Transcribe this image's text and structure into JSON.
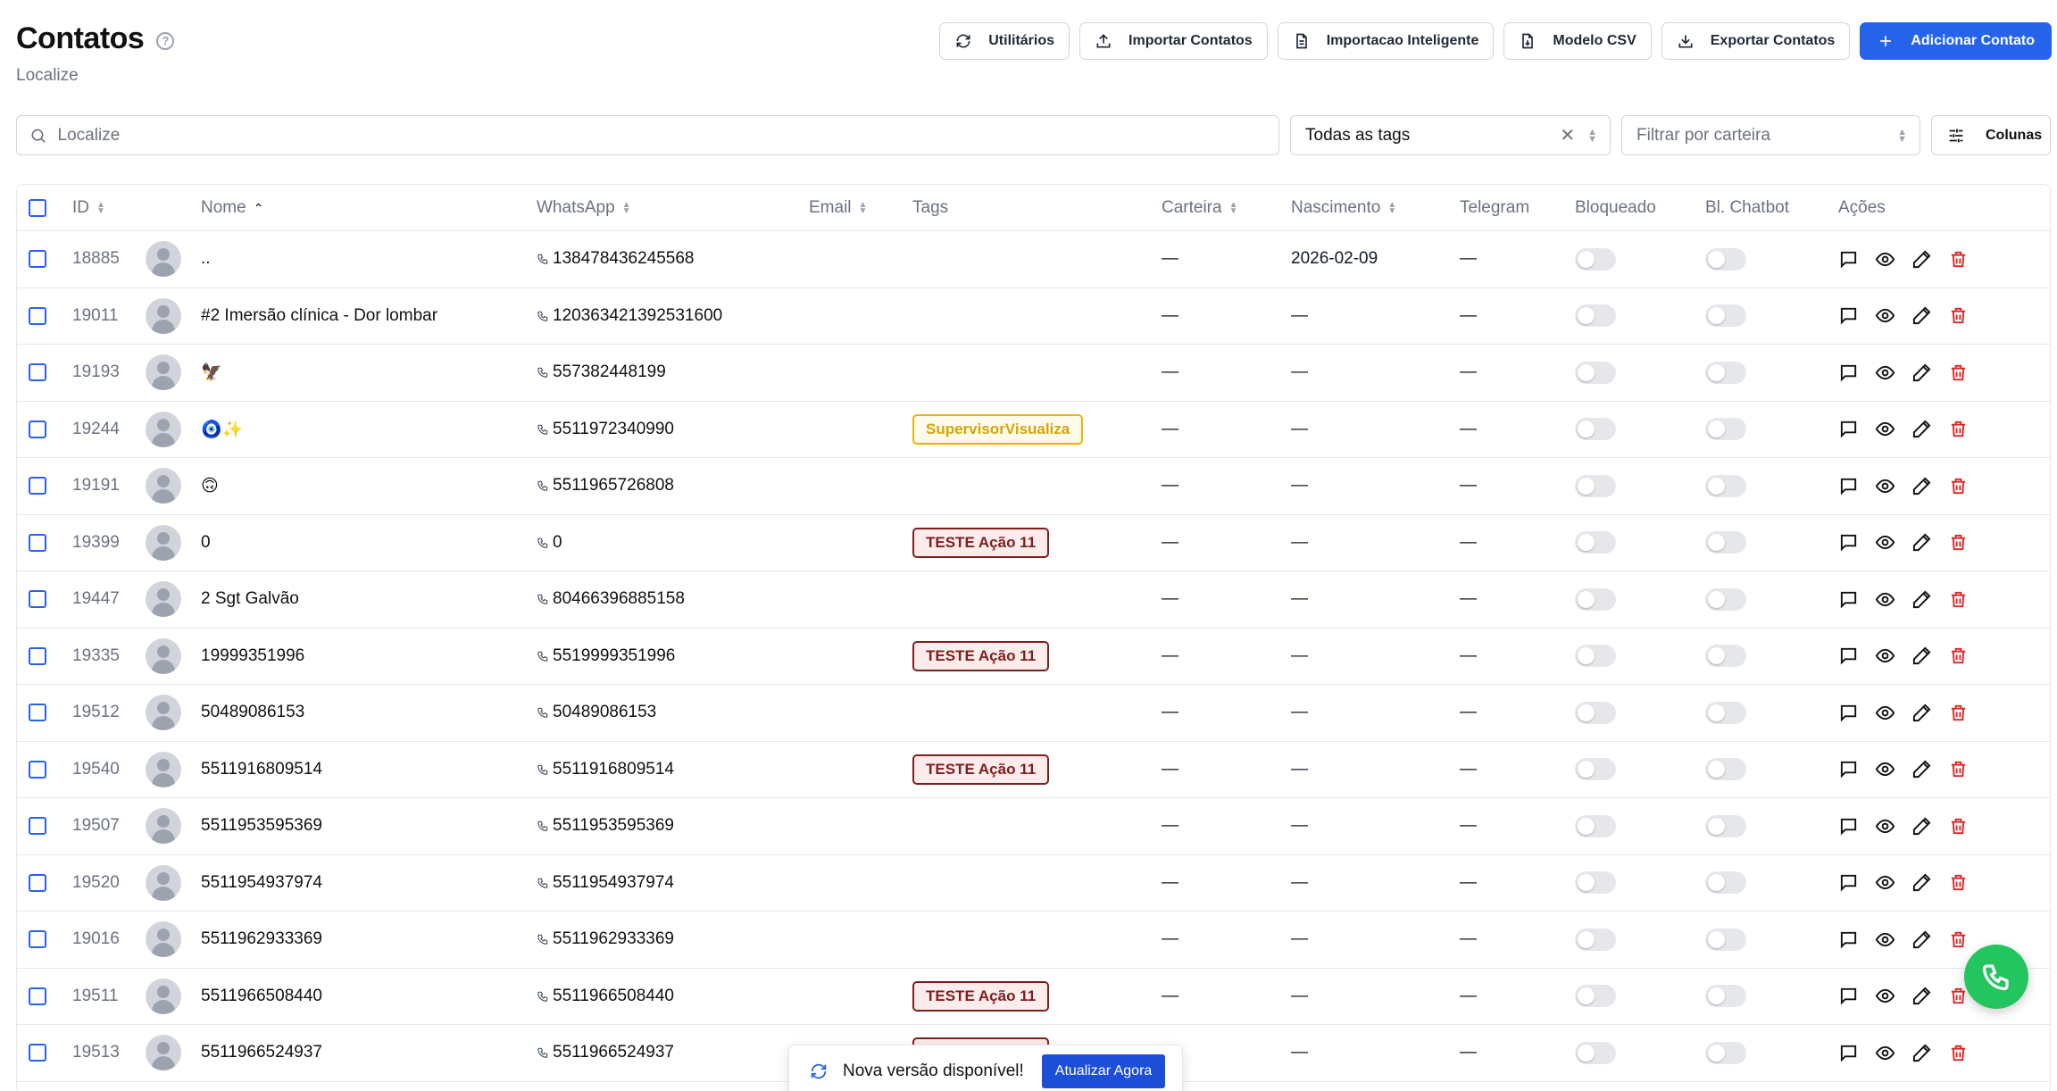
{
  "header": {
    "title": "Contatos",
    "subtitle": "Localize"
  },
  "toolbar": {
    "utilities": "Utilitários",
    "import_contacts": "Importar Contatos",
    "smart_import": "Importacao Inteligente",
    "csv_model": "Modelo CSV",
    "export_contacts": "Exportar Contatos",
    "add_contact": "Adicionar Contato"
  },
  "filters": {
    "search_placeholder": "Localize",
    "tags_selected": "Todas as tags",
    "wallet_placeholder": "Filtrar por carteira",
    "columns_label": "Colunas"
  },
  "table": {
    "headers": {
      "id": "ID",
      "name": "Nome",
      "whatsapp": "WhatsApp",
      "email": "Email",
      "tags": "Tags",
      "wallet": "Carteira",
      "birth": "Nascimento",
      "telegram": "Telegram",
      "blocked": "Bloqueado",
      "chatbot": "Bl. Chatbot",
      "actions": "Ações"
    },
    "dash": "—",
    "rows": [
      {
        "id": "18885",
        "name": "..",
        "whatsapp": "138478436245568",
        "tag": "",
        "birth": "2026-02-09"
      },
      {
        "id": "19011",
        "name": "#2 Imersão clínica - Dor lombar",
        "whatsapp": "120363421392531600",
        "tag": "",
        "birth": "—"
      },
      {
        "id": "19193",
        "name": "🦅",
        "whatsapp": "557382448199",
        "tag": "",
        "birth": "—"
      },
      {
        "id": "19244",
        "name": "🧿✨",
        "whatsapp": "5511972340990",
        "tag": "SupervisorVisualiza",
        "tag_color": "yellow",
        "birth": "—"
      },
      {
        "id": "19191",
        "name": "🙃",
        "whatsapp": "5511965726808",
        "tag": "",
        "birth": "—"
      },
      {
        "id": "19399",
        "name": "0",
        "whatsapp": "0",
        "tag": "TESTE Ação 11",
        "tag_color": "red",
        "birth": "—"
      },
      {
        "id": "19447",
        "name": "2 Sgt Galvão",
        "whatsapp": "80466396885158",
        "tag": "",
        "birth": "—"
      },
      {
        "id": "19335",
        "name": "19999351996",
        "whatsapp": "5519999351996",
        "tag": "TESTE Ação 11",
        "tag_color": "red",
        "birth": "—"
      },
      {
        "id": "19512",
        "name": "50489086153",
        "whatsapp": "50489086153",
        "tag": "",
        "birth": "—"
      },
      {
        "id": "19540",
        "name": "5511916809514",
        "whatsapp": "5511916809514",
        "tag": "TESTE Ação 11",
        "tag_color": "red",
        "birth": "—"
      },
      {
        "id": "19507",
        "name": "5511953595369",
        "whatsapp": "5511953595369",
        "tag": "",
        "birth": "—"
      },
      {
        "id": "19520",
        "name": "5511954937974",
        "whatsapp": "5511954937974",
        "tag": "",
        "birth": "—"
      },
      {
        "id": "19016",
        "name": "5511962933369",
        "whatsapp": "5511962933369",
        "tag": "",
        "birth": "—"
      },
      {
        "id": "19511",
        "name": "5511966508440",
        "whatsapp": "5511966508440",
        "tag": "TESTE Ação 11",
        "tag_color": "red",
        "birth": "—"
      },
      {
        "id": "19513",
        "name": "5511966524937",
        "whatsapp": "5511966524937",
        "tag": "TESTE Ação 11",
        "tag_color": "red",
        "birth": "—"
      }
    ]
  },
  "toast": {
    "message": "Nova versão disponível!",
    "action": "Atualizar Agora"
  },
  "colors": {
    "primary": "#2563eb",
    "whatsapp_fab": "#22c55e",
    "tag_red": "#7f1d1d",
    "tag_yellow": "#eab308",
    "delete": "#dc2626"
  }
}
